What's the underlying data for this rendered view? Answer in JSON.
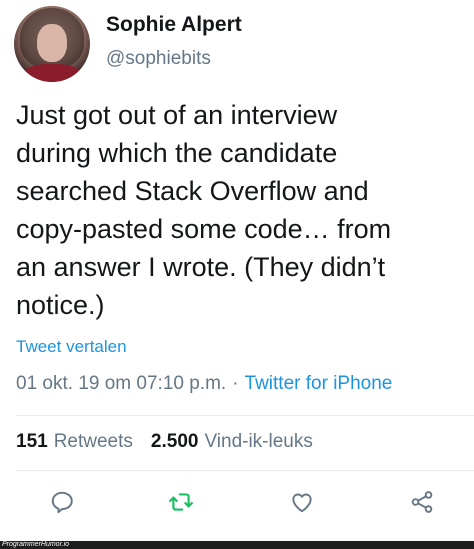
{
  "author": {
    "display_name": "Sophie Alpert",
    "handle": "@sophiebits"
  },
  "tweet": {
    "text": "Just got out of an interview\nduring which the candidate\nsearched Stack Overflow and\ncopy-pasted some code… from\nan answer I wrote. (They didn’t\nnotice.)",
    "translate_label": "Tweet vertalen",
    "timestamp": "01 okt. 19 om 07:10 p.m.",
    "separator": "·",
    "source": "Twitter for iPhone"
  },
  "stats": {
    "retweets_count": "151",
    "retweets_label": "Retweets",
    "likes_count": "2.500",
    "likes_label": "Vind-ik-leuks"
  },
  "actions": [
    {
      "icon": "reply-icon"
    },
    {
      "icon": "retweet-icon",
      "color": "#17bf63"
    },
    {
      "icon": "like-icon"
    },
    {
      "icon": "share-icon"
    }
  ],
  "watermark": "ProgrammerHumor.io",
  "colors": {
    "link": "#1b95e0",
    "muted": "#657786",
    "text": "#14171a",
    "retweet": "#17bf63"
  }
}
